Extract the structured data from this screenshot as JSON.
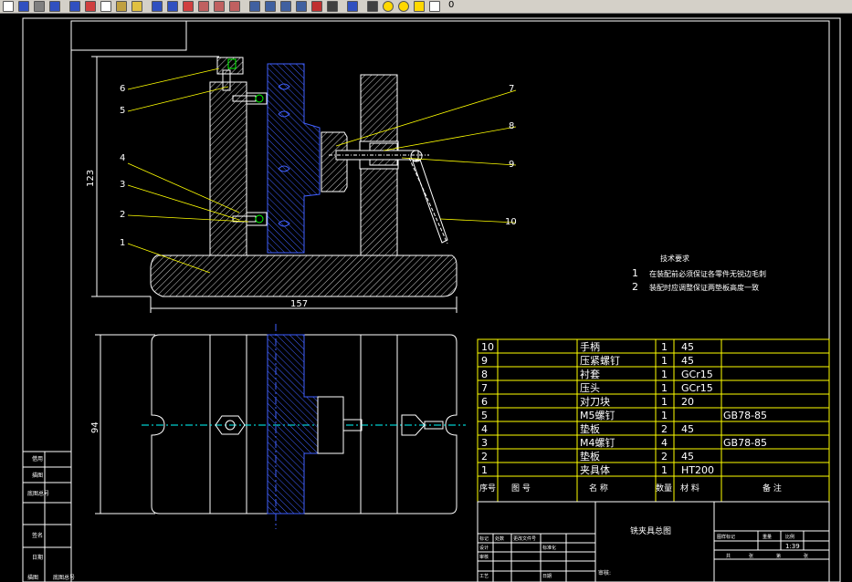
{
  "toolbar": {
    "icons": [
      "new-icon",
      "save-icon",
      "print-icon",
      "preview-icon",
      "publish-icon",
      "cut-icon",
      "copy-icon",
      "paste-icon",
      "match-icon",
      "undo-icon",
      "redo-icon",
      "pan-icon",
      "zoom-icon",
      "zoom-window-icon",
      "zoom-previous-icon",
      "properties-icon",
      "design-center-icon",
      "tool-palette-icon",
      "sheet-set-icon",
      "markup-icon",
      "calculator-icon",
      "help-icon",
      "layer-icon",
      "lightbulb-icon",
      "sun-icon",
      "lock-icon",
      "color-icon"
    ],
    "layer_value": "0"
  },
  "drawing": {
    "dim_height": "123",
    "dim_width": "157",
    "dim_plan_height": "94",
    "callouts": [
      "1",
      "2",
      "3",
      "4",
      "5",
      "6",
      "7",
      "8",
      "9",
      "10"
    ],
    "tech_req_title": "技术要求",
    "tech_req": [
      {
        "num": "1",
        "text": "在装配前必须保证各零件无锐边毛刺"
      },
      {
        "num": "2",
        "text": "装配时应调整保证两垫板高度一致"
      }
    ],
    "bom_rows": [
      {
        "no": "10",
        "name": "手柄",
        "qty": "1",
        "mat": "45",
        "note": ""
      },
      {
        "no": "9",
        "name": "压紧螺钉",
        "qty": "1",
        "mat": "45",
        "note": ""
      },
      {
        "no": "8",
        "name": "衬套",
        "qty": "1",
        "mat": "GCr15",
        "note": ""
      },
      {
        "no": "7",
        "name": "压头",
        "qty": "1",
        "mat": "GCr15",
        "note": ""
      },
      {
        "no": "6",
        "name": "对刀块",
        "qty": "1",
        "mat": "20",
        "note": ""
      },
      {
        "no": "5",
        "name": "M5螺钉",
        "qty": "1",
        "mat": "",
        "note": "GB78-85"
      },
      {
        "no": "4",
        "name": "垫板",
        "qty": "2",
        "mat": "45",
        "note": ""
      },
      {
        "no": "3",
        "name": "M4螺钉",
        "qty": "4",
        "mat": "",
        "note": "GB78-85"
      },
      {
        "no": "2",
        "name": "垫板",
        "qty": "2",
        "mat": "45",
        "note": ""
      },
      {
        "no": "1",
        "name": "夹具体",
        "qty": "1",
        "mat": "HT200",
        "note": ""
      }
    ],
    "bom_header": {
      "no": "序号",
      "code": "图 号",
      "name": "名 称",
      "qty": "数量",
      "mat": "材 料",
      "note": "备 注"
    },
    "title_block": {
      "drawing_title": "铣夹具总图",
      "scale": "1:39",
      "approved_label": "审核:",
      "left_labels": [
        "标记",
        "处数",
        "更改文件号",
        "设计",
        "审核",
        "工艺"
      ],
      "mid_labels": [
        "标准化",
        "日期"
      ],
      "right_labels": [
        "图样标记",
        "重量",
        "比例",
        "共",
        "张",
        "第",
        "张"
      ]
    },
    "side_labels": [
      "借用",
      "描图",
      "底图总号",
      "签名",
      "日期"
    ],
    "bottom_labels": [
      "描图",
      "底图总号"
    ]
  }
}
